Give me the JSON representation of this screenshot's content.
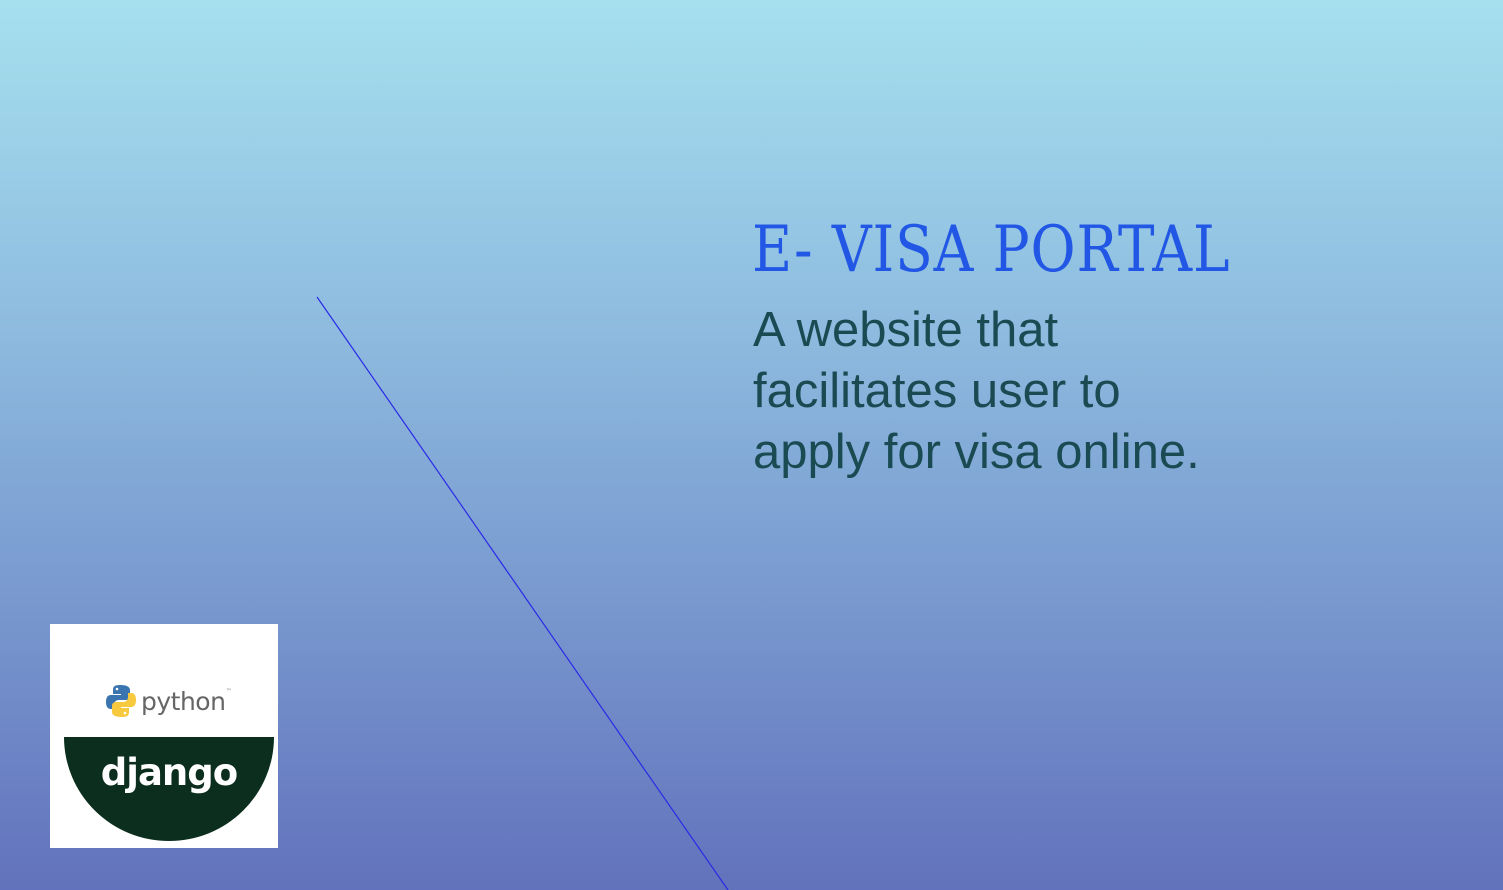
{
  "hero": {
    "title": "E- VISA PORTAL",
    "description": "A website that facilitates user to apply for visa online."
  },
  "logo": {
    "python_text": "python",
    "python_tm": "™",
    "django_text": "django"
  },
  "colors": {
    "title": "#2257e6",
    "description": "#1b4b52",
    "line": "#2a2ae6",
    "django_green": "#0c2e1e"
  }
}
